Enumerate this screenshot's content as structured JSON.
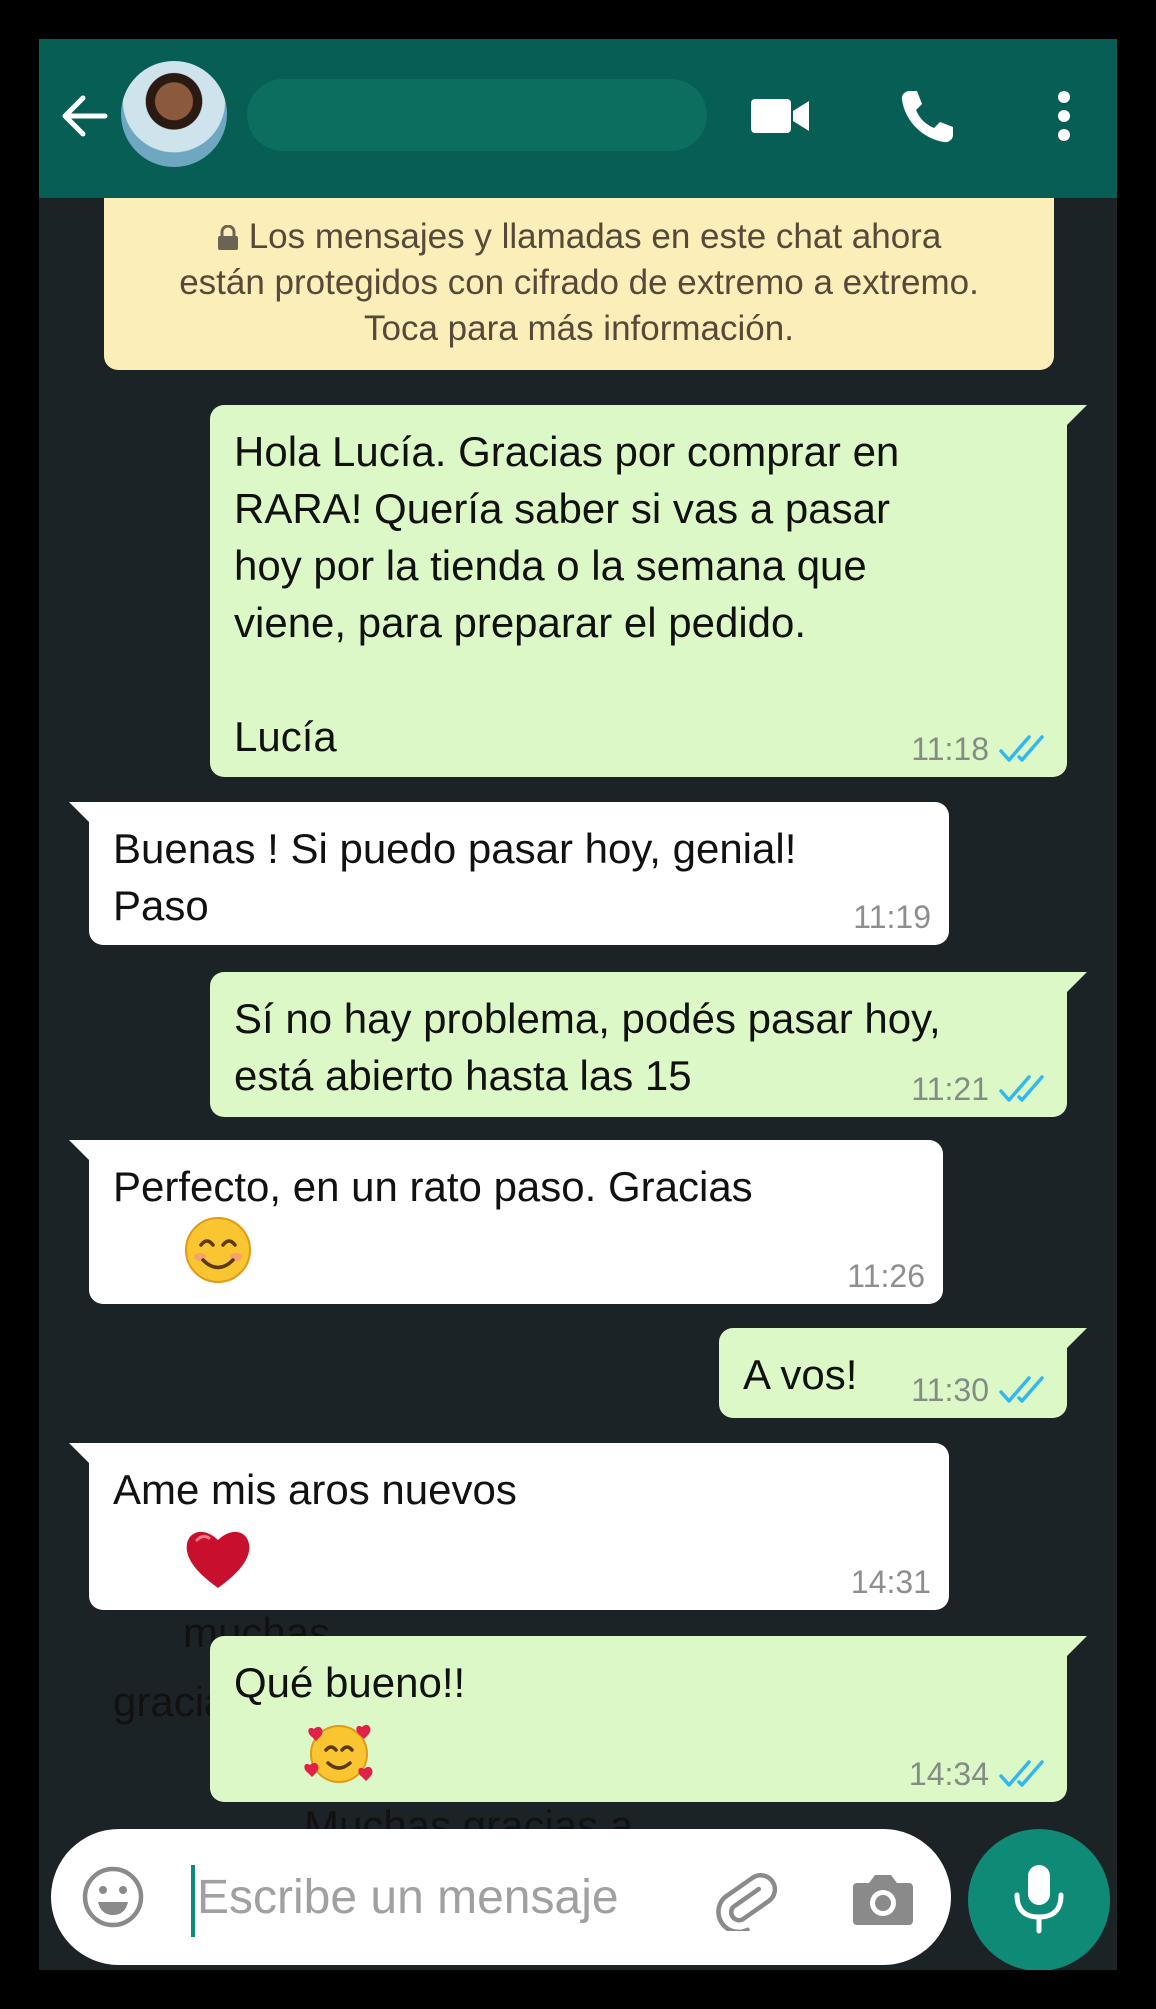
{
  "header": {
    "contact_name": "",
    "icons": [
      "back-arrow-icon",
      "avatar",
      "video-camera-icon",
      "phone-icon",
      "more-vertical-icon"
    ]
  },
  "colors": {
    "header": "#075e54",
    "chat_background": "#1c2326",
    "outgoing_bubble": "#dcf8c6",
    "incoming_bubble": "#ffffff",
    "encryption_notice": "#fbeeb8",
    "read_ticks": "#34b7f1",
    "mic_button": "#0f8a77"
  },
  "encryption_notice": {
    "line1": "Los mensajes y llamadas en este chat ahora",
    "line2": "están protegidos con cifrado de extremo a extremo.",
    "line3": "Toca para más información."
  },
  "messages": [
    {
      "direction": "out",
      "text": "Hola Lucía. Gracias por comprar en\nRARA! Quería saber si vas a pasar\nhoy por la tienda o la semana que\nviene, para preparar el pedido.\n\nLucía",
      "time": "11:18",
      "status": "read"
    },
    {
      "direction": "in",
      "text": "Buenas ! Si puedo pasar hoy, genial!\nPaso",
      "time": "11:19"
    },
    {
      "direction": "out",
      "text": "Sí no hay problema, podés pasar hoy,\nestá abierto hasta las 15",
      "time": "11:21",
      "status": "read"
    },
    {
      "direction": "in",
      "text_before": "Perfecto, en un rato paso. Gracias",
      "emoji": "smiling-face-icon",
      "time": "11:26"
    },
    {
      "direction": "out",
      "text": "A vos!",
      "time": "11:30",
      "status": "read"
    },
    {
      "direction": "in",
      "text_before": "Ame mis aros nuevos",
      "emoji": "red-heart-icon",
      "text_after": "muchas\ngracias!",
      "time": "14:31"
    },
    {
      "direction": "out",
      "text_before": "Qué bueno!!",
      "emoji": "smiling-face-with-hearts-icon",
      "text_after": "Muchas gracias a\nvos",
      "time": "14:34",
      "status": "read"
    }
  ],
  "input": {
    "placeholder": "Escribe un mensaje",
    "value": "",
    "icons": [
      "emoji-icon",
      "attach-icon",
      "camera-icon",
      "mic-icon"
    ]
  }
}
